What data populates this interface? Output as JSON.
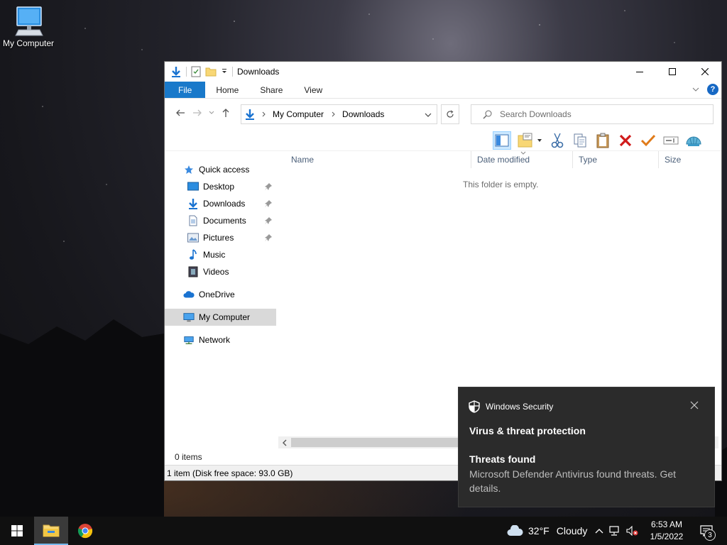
{
  "desktop": {
    "icons": [
      {
        "label": "My Computer",
        "icon": "computer-icon"
      }
    ]
  },
  "explorer": {
    "title": "Downloads",
    "ribbon_tabs": [
      "File",
      "Home",
      "Share",
      "View"
    ],
    "address": {
      "root": "My Computer",
      "current": "Downloads"
    },
    "search_placeholder": "Search Downloads",
    "nav_pane": {
      "quick_access": "Quick access",
      "pinned": [
        "Desktop",
        "Downloads",
        "Documents",
        "Pictures"
      ],
      "unpinned": [
        "Music",
        "Videos"
      ],
      "onedrive": "OneDrive",
      "my_computer": "My Computer",
      "network": "Network"
    },
    "columns": [
      "Name",
      "Date modified",
      "Type",
      "Size"
    ],
    "empty_message": "This folder is empty.",
    "items_count": "0 items",
    "status": "1 item (Disk free space: 93.0 GB)"
  },
  "toast": {
    "app": "Windows Security",
    "heading": "Virus & threat protection",
    "subheading": "Threats found",
    "body": "Microsoft Defender Antivirus found threats. Get details."
  },
  "taskbar": {
    "weather": {
      "temp": "32°F",
      "condition": "Cloudy"
    },
    "time": "6:53 AM",
    "date": "1/5/2022",
    "notification_count": "3"
  },
  "colors": {
    "accent": "#1979ca",
    "selection": "#cce8ff",
    "toast_bg": "#2b2b2b",
    "taskbar_bg": "#101010"
  }
}
